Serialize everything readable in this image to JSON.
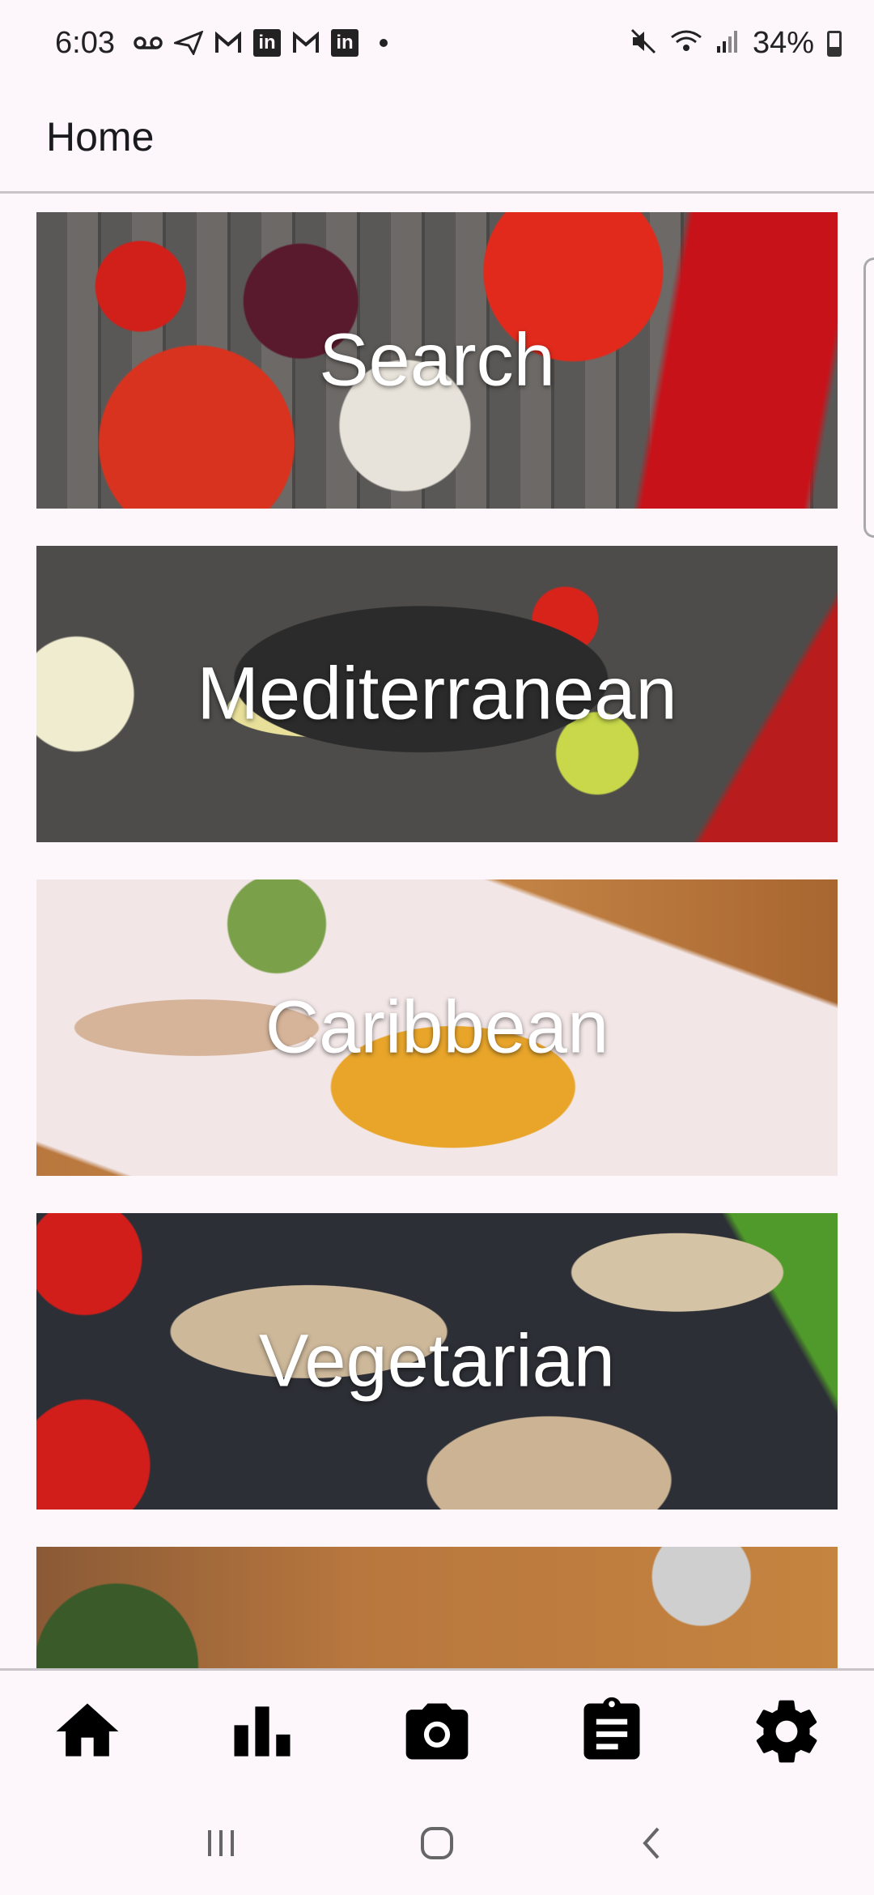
{
  "status_bar": {
    "time": "6:03",
    "battery": "34%"
  },
  "app_bar": {
    "title": "Home"
  },
  "categories": [
    {
      "label": "Search"
    },
    {
      "label": "Mediterranean"
    },
    {
      "label": "Caribbean"
    },
    {
      "label": "Vegetarian"
    },
    {
      "label": ""
    }
  ],
  "bottom_nav": {
    "items": [
      {
        "icon": "home-icon"
      },
      {
        "icon": "bar-chart-icon"
      },
      {
        "icon": "camera-icon"
      },
      {
        "icon": "clipboard-icon"
      },
      {
        "icon": "gear-icon"
      }
    ]
  },
  "system_nav": {
    "items": [
      {
        "icon": "recents-icon"
      },
      {
        "icon": "home-circle-icon"
      },
      {
        "icon": "back-icon"
      }
    ]
  }
}
